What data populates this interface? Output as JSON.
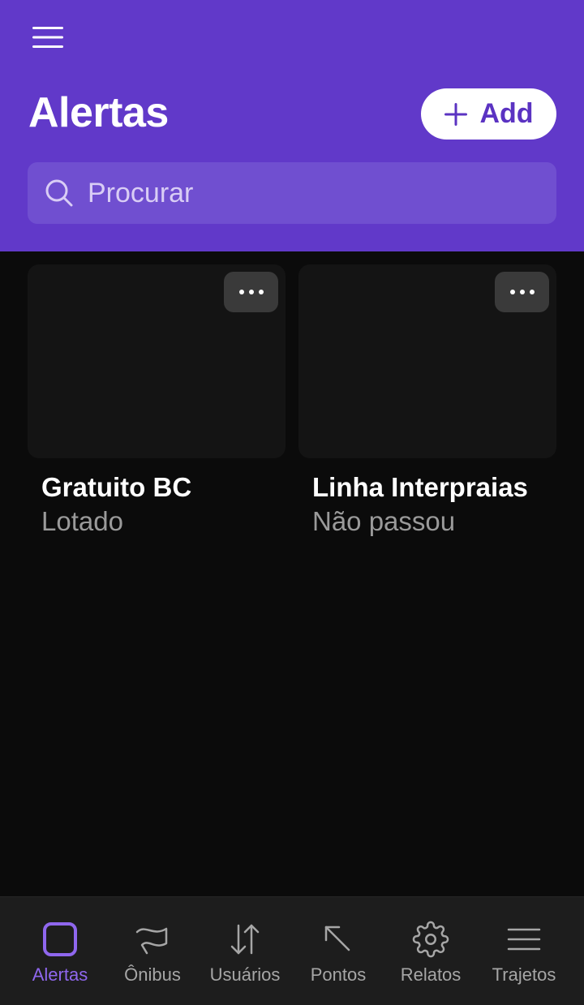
{
  "header": {
    "title": "Alertas",
    "add_label": "Add",
    "search_placeholder": "Procurar"
  },
  "cards": [
    {
      "title": "Gratuito BC",
      "subtitle": "Lotado"
    },
    {
      "title": "Linha Interpraias",
      "subtitle": "Não passou"
    }
  ],
  "tabs": [
    {
      "label": "Alertas",
      "icon": "square-icon",
      "active": true
    },
    {
      "label": "Ônibus",
      "icon": "flag-icon",
      "active": false
    },
    {
      "label": "Usuários",
      "icon": "swap-vertical-icon",
      "active": false
    },
    {
      "label": "Pontos",
      "icon": "arrow-up-left-icon",
      "active": false
    },
    {
      "label": "Relatos",
      "icon": "gear-icon",
      "active": false
    },
    {
      "label": "Trajetos",
      "icon": "lines-icon",
      "active": false
    }
  ],
  "colors": {
    "header_bg": "#6139c9",
    "accent": "#8f67ee",
    "background": "#0b0b0b",
    "tabbar_bg": "#1d1d1d"
  }
}
